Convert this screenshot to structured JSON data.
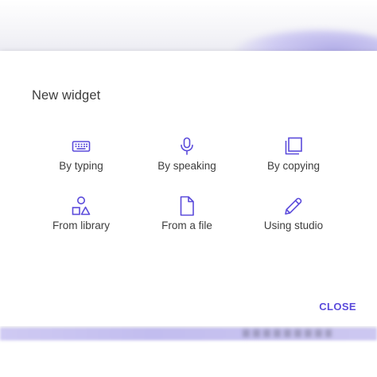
{
  "dialog": {
    "title": "New widget",
    "close_label": "CLOSE",
    "accent_color": "#5b4bdb",
    "options": [
      {
        "label": "By typing",
        "icon": "keyboard-icon"
      },
      {
        "label": "By speaking",
        "icon": "microphone-icon"
      },
      {
        "label": "By copying",
        "icon": "copy-icon"
      },
      {
        "label": "From library",
        "icon": "shapes-icon"
      },
      {
        "label": "From a file",
        "icon": "file-icon"
      },
      {
        "label": "Using studio",
        "icon": "pencil-icon"
      }
    ]
  }
}
